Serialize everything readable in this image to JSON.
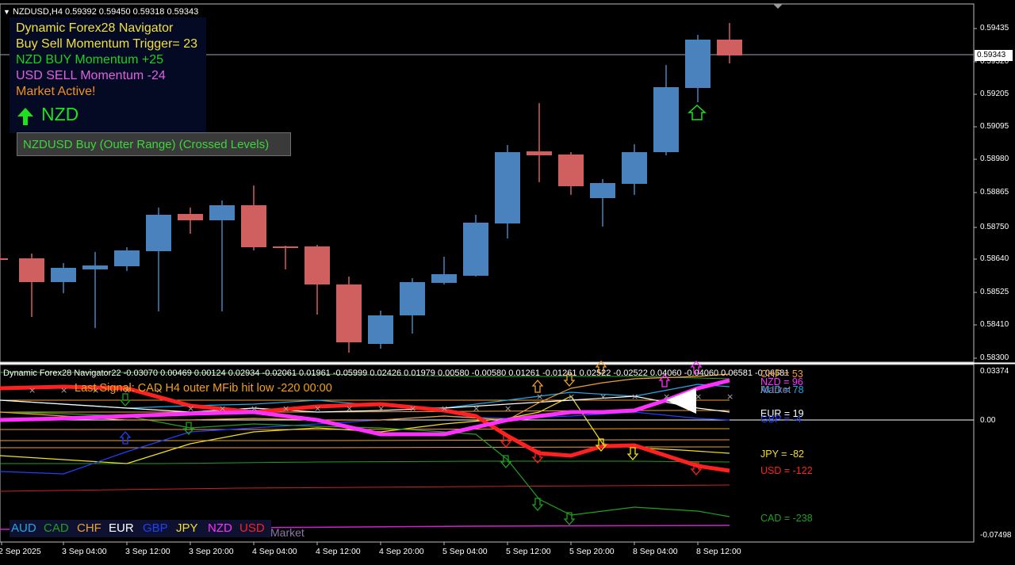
{
  "header": {
    "symbol_info": "NZDUSD,H4  0.59392 0.59450 0.59318 0.59343"
  },
  "panel": {
    "line1": "Dynamic Forex28 Navigator",
    "line2": "Buy Sell Momentum Trigger= 23",
    "line3": "NZD BUY Momentum +25",
    "line4": "USD SELL Momentum -24",
    "line5": "Market Active!",
    "currency": "NZD",
    "signal": "NZDUSD Buy (Outer Range) (Crossed Levels)"
  },
  "price_axis": {
    "labels": [
      "0.59435",
      "0.59320",
      "0.59205",
      "0.59095",
      "0.58980",
      "0.58865",
      "0.58750",
      "0.58640",
      "0.58525",
      "0.58410",
      "0.58300"
    ],
    "current": "0.59343"
  },
  "time_axis": [
    "2 Sep 2025",
    "3 Sep 04:00",
    "3 Sep 12:00",
    "3 Sep 20:00",
    "4 Sep 04:00",
    "4 Sep 12:00",
    "4 Sep 20:00",
    "5 Sep 04:00",
    "5 Sep 12:00",
    "5 Sep 20:00",
    "8 Sep 04:00",
    "8 Sep 12:00"
  ],
  "indicator": {
    "header": "Dynamic Forex28 Navigator22 -0.03070 0.00469 0.00124 0.02934 -0.02061 0.01961 -0.05999 0.02426 0.01979 0.00580 -0.00580 0.01261 -0.01261 0.02522 -0.02522 0.04060 -0.04060 0.06581 -0.06581",
    "last_signal": "Last Signal:  CAD H4 outer MFib hit low -220 00:00",
    "axis_top": "0.03374",
    "axis_zero": "0.00",
    "axis_bottom": "-0.07498",
    "currency_values": [
      {
        "text": "CHF = 53",
        "color": "#f0a030"
      },
      {
        "text": "NZD = 96",
        "color": "#ff30ff"
      },
      {
        "text": "AUD = 78",
        "color": "#20a8e8"
      },
      {
        "text": "Market",
        "color": "#8a7aa8"
      },
      {
        "text": "EUR = 19",
        "color": "#ffffff"
      },
      {
        "text": "GBP = -4",
        "color": "#2040ff"
      },
      {
        "text": "JPY = -82",
        "color": "#f0e020"
      },
      {
        "text": "USD = -122",
        "color": "#ff2020"
      },
      {
        "text": "CAD = -238",
        "color": "#20a020"
      }
    ],
    "legend": [
      {
        "text": "AUD",
        "color": "#20a8e8"
      },
      {
        "text": "CAD",
        "color": "#20a020"
      },
      {
        "text": "CHF",
        "color": "#f0a030"
      },
      {
        "text": "EUR",
        "color": "#ffffff"
      },
      {
        "text": "GBP",
        "color": "#2040ff"
      },
      {
        "text": "JPY",
        "color": "#f0e020"
      },
      {
        "text": "NZD",
        "color": "#ff30ff"
      },
      {
        "text": "USD",
        "color": "#ff2020"
      }
    ],
    "market_label": "Market"
  },
  "colors": {
    "bull": "#4a82bd",
    "bear": "#d06060",
    "panel_bg": "#050a24"
  }
}
